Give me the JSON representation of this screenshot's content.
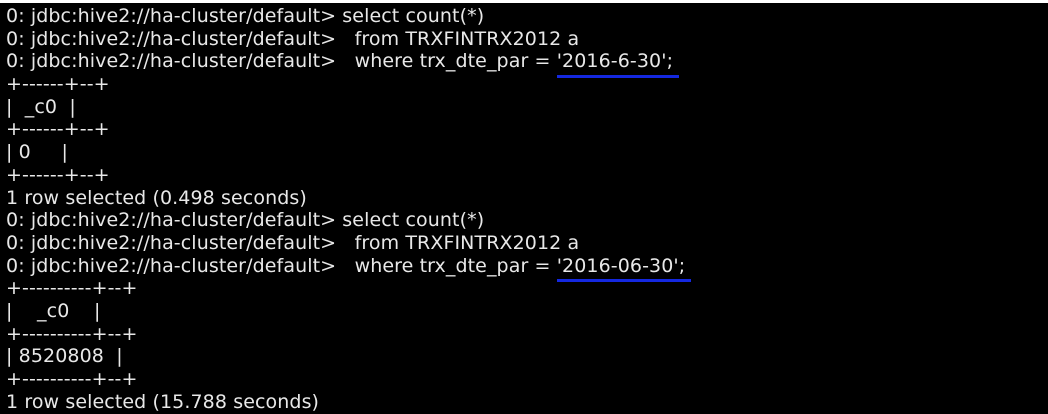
{
  "terminal": {
    "query1": {
      "line1": "0: jdbc:hive2://ha-cluster/default> select count(*)",
      "line2": "0: jdbc:hive2://ha-cluster/default>   from TRXFINTRX2012 a",
      "line3_prefix": "0: jdbc:hive2://ha-cluster/default>   where trx_dte_par = ",
      "line3_highlight": "'2016-6-30';",
      "table_border": "+------+--+",
      "table_header": "|  _c0  |",
      "table_row": "| 0     |",
      "status": "1 row selected (0.498 seconds)"
    },
    "query2": {
      "line1": "0: jdbc:hive2://ha-cluster/default> select count(*)",
      "line2": "0: jdbc:hive2://ha-cluster/default>   from TRXFINTRX2012 a",
      "line3_prefix": "0: jdbc:hive2://ha-cluster/default>   where trx_dte_par = ",
      "line3_highlight": "'2016-06-30';",
      "table_border": "+----------+--+",
      "table_header": "|    _c0    |",
      "table_row": "| 8520808  |",
      "status": "1 row selected (15.788 seconds)"
    },
    "colors": {
      "background": "#000000",
      "text": "#e8e8e8",
      "underline": "#1428e0"
    }
  }
}
